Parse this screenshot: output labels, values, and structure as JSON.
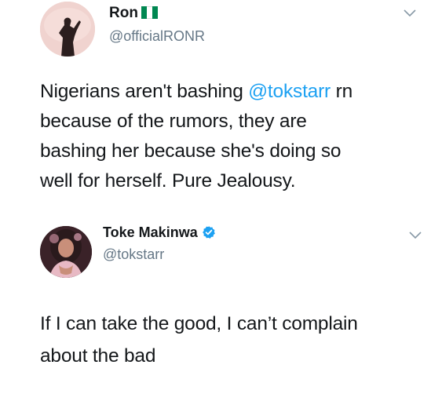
{
  "tweets": [
    {
      "name": "Ron",
      "handle": "@officialRONR",
      "flag_colors": [
        "#008751",
        "#ffffff",
        "#008751"
      ],
      "lines": [
        {
          "pre": "Nigerians aren't bashing ",
          "mention": "@tokstarr",
          "post": " rn"
        },
        {
          "text": "because of the rumors,  they are"
        },
        {
          "text": "bashing her because she's doing so"
        },
        {
          "text": "well for herself.  Pure Jealousy."
        }
      ]
    },
    {
      "name": "Toke Makinwa",
      "handle": "@tokstarr",
      "verified": true,
      "lines": [
        {
          "text": "If I can take the good, I can’t complain"
        },
        {
          "text": "about the bad"
        }
      ]
    }
  ],
  "colors": {
    "link": "#1da1f2",
    "verified_badge": "#1da1f2",
    "secondary_text": "#657786"
  },
  "icons": [
    "avatar",
    "nigeria-flag-icon",
    "verified-badge-icon",
    "chevron-down-icon"
  ]
}
